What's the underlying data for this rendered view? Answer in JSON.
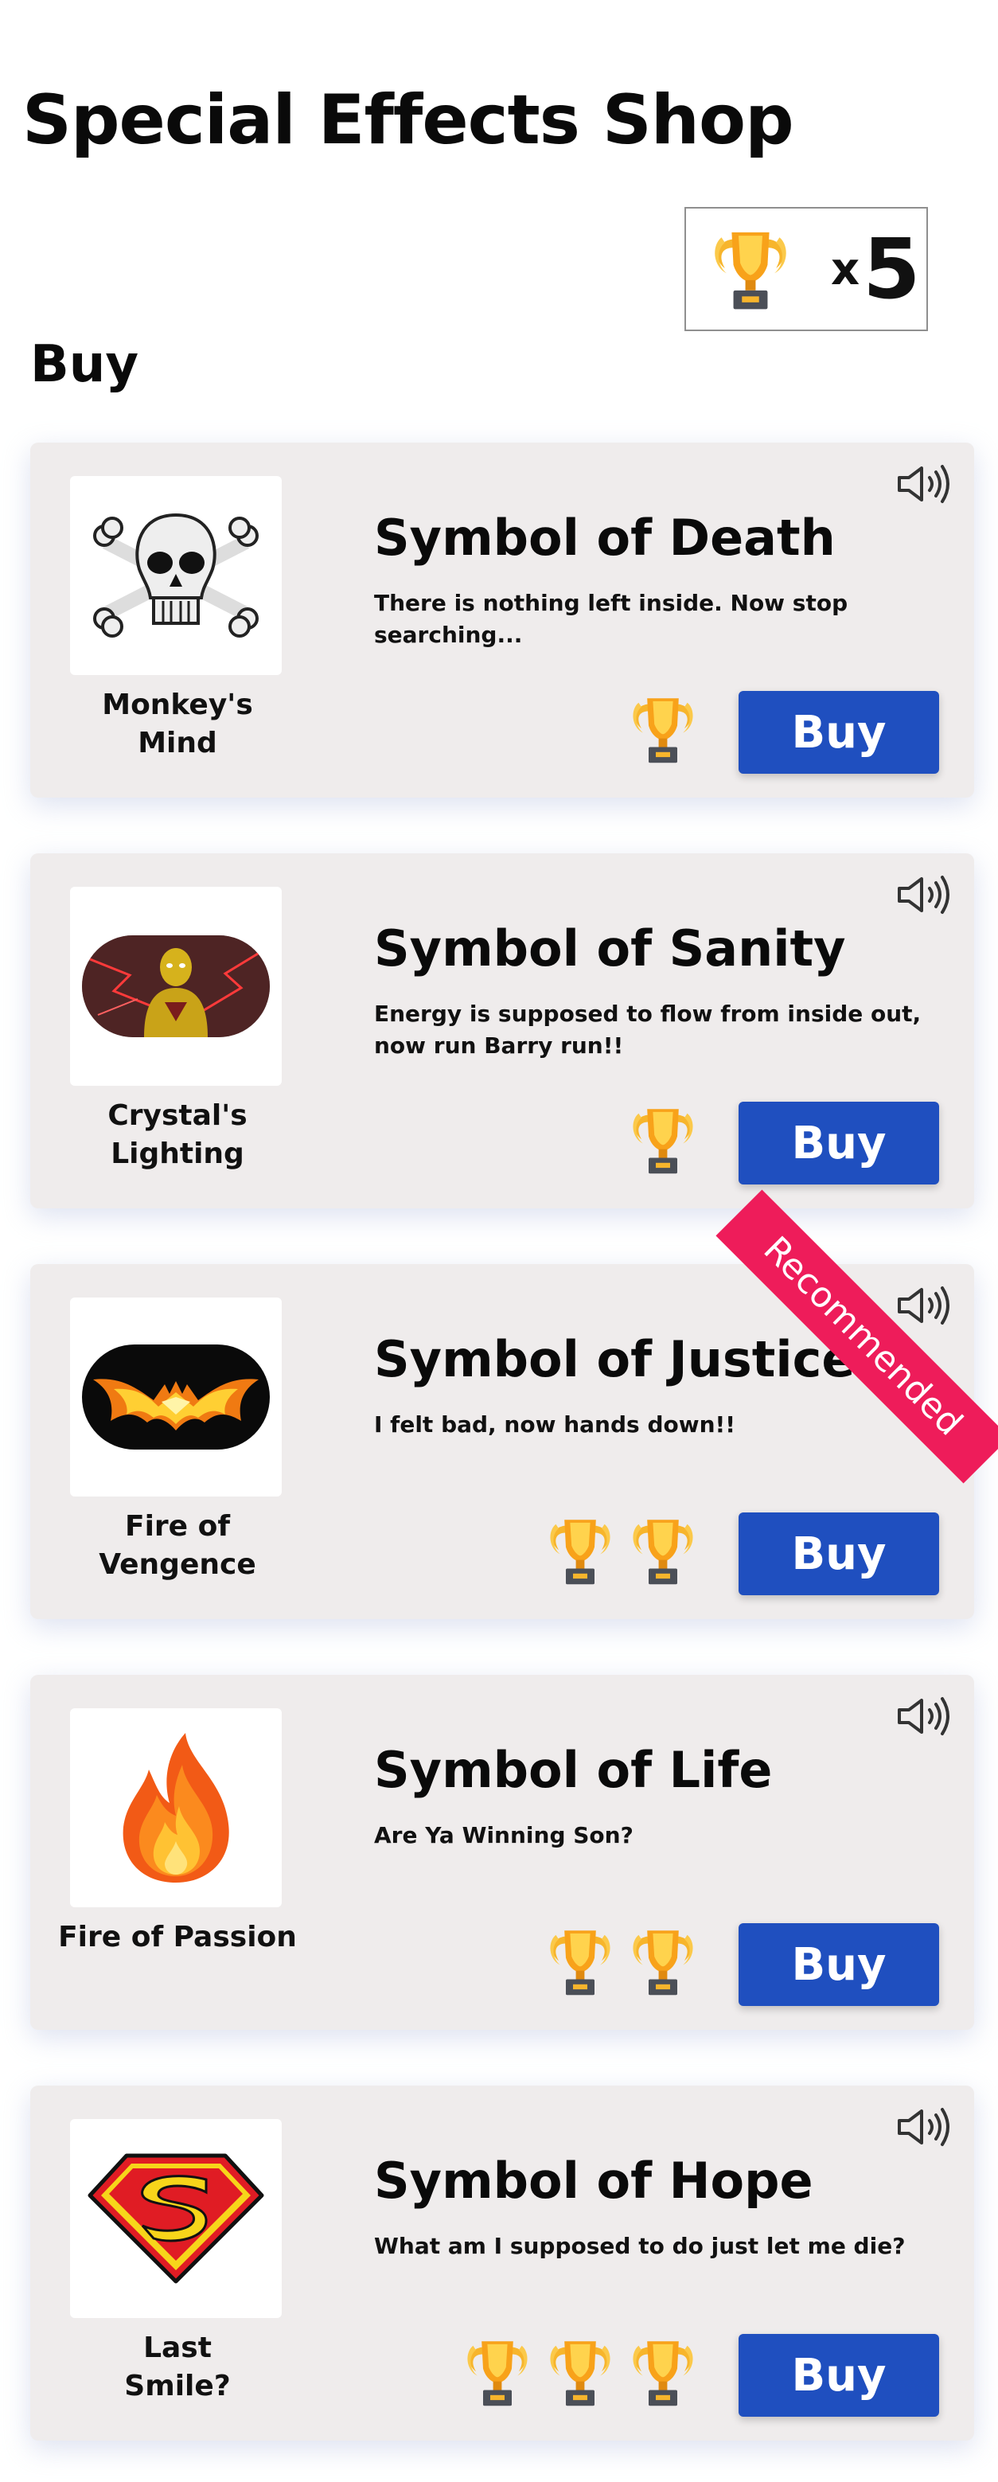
{
  "page": {
    "title": "Special Effects Shop",
    "buy_heading": "Buy"
  },
  "wallet": {
    "prefix": "x",
    "count": "5",
    "icon": "trophy-icon"
  },
  "buy_button_label": "Buy",
  "ribbon_label": "Recommended",
  "colors": {
    "accent": "#1f4fbf",
    "card_bg": "#efecec",
    "ribbon": "#ee1c5a",
    "trophy_gold": "#f7b52c"
  },
  "items": [
    {
      "thumb_label_1": "Monkey's",
      "thumb_label_2": "Mind",
      "title": "Symbol of Death",
      "description": "There is nothing left inside. Now stop searching...",
      "price": 1,
      "thumbnail_icon": "skull-crossbones-icon"
    },
    {
      "thumb_label_1": "Crystal's",
      "thumb_label_2": "Lighting",
      "title": "Symbol of Sanity",
      "description": "Energy is supposed to flow from inside out, now run Barry run!!",
      "price": 1,
      "thumbnail_icon": "speedster-icon"
    },
    {
      "thumb_label_1": "Fire of",
      "thumb_label_2": "Vengence",
      "title": "Symbol of Justice",
      "description": "I felt bad, now hands down!!",
      "price": 2,
      "thumbnail_icon": "flaming-bat-icon",
      "recommended": true
    },
    {
      "thumb_label_1": "Fire of Passion",
      "thumb_label_2": "",
      "title": "Symbol of Life",
      "description": "Are Ya Winning Son?",
      "price": 2,
      "thumbnail_icon": "flame-icon"
    },
    {
      "thumb_label_1": "Last",
      "thumb_label_2": "Smile?",
      "title": "Symbol of Hope",
      "description": "What am I supposed to do just let me die?",
      "price": 3,
      "thumbnail_icon": "super-shield-icon"
    }
  ]
}
